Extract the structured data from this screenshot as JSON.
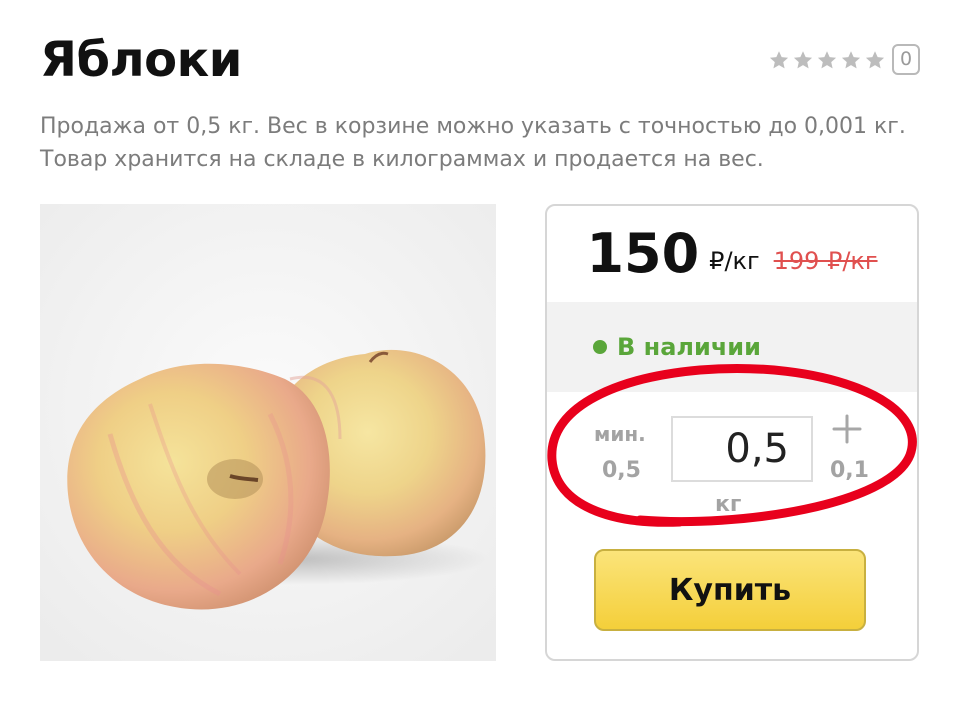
{
  "product": {
    "title": "Яблоки",
    "description": "Продажа от 0,5 кг. Вес в корзине можно указать с точностью до 0,001 кг. Товар хранится на складе в килограммах и продается на вес.",
    "rating": {
      "stars": 5,
      "filled": 0,
      "reviews_count": "0"
    },
    "image_icon": "apples-photo"
  },
  "buy_box": {
    "price": "150",
    "price_unit": "₽/кг",
    "old_price": "199 ₽/кг",
    "stock_status": "В наличии",
    "quantity": {
      "min_label": "мин.",
      "min_value": "0,5",
      "value": "0,5",
      "step": "0,1",
      "unit": "кг",
      "plus_icon": "plus-icon"
    },
    "buy_label": "Купить"
  },
  "colors": {
    "price_old": "#e0504f",
    "in_stock": "#5aa63a",
    "buy_button": "#f4cf3a",
    "annotation_ring": "#e8001c"
  }
}
